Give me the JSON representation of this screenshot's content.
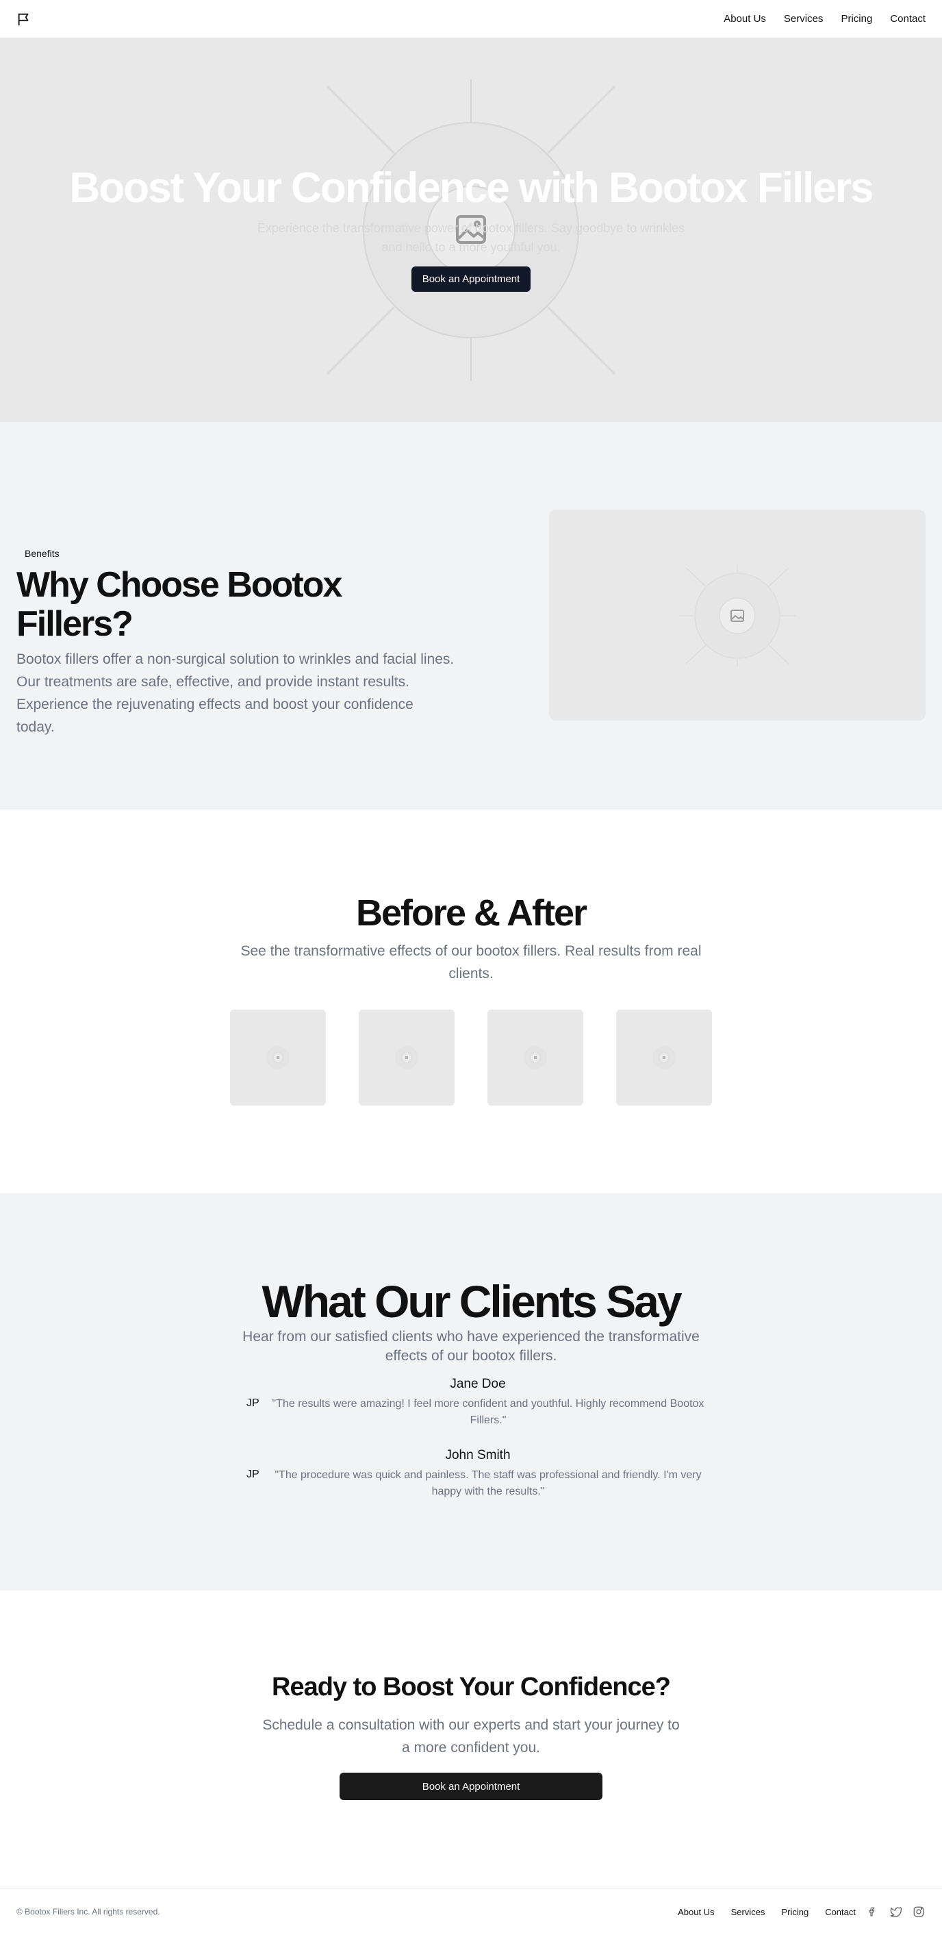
{
  "header": {
    "logo_icon": "flag-icon",
    "nav": [
      "About Us",
      "Services",
      "Pricing",
      "Contact"
    ]
  },
  "hero": {
    "title": "Boost Your Confidence with Bootox Fillers",
    "subtitle": "Experience the transformative power of bootox fillers. Say goodbye to wrinkles and hello to a more youthful you.",
    "cta": "Book an Appointment",
    "image_icon": "image-placeholder-icon"
  },
  "benefits": {
    "pill": "Benefits",
    "title": "Why Choose Bootox Fillers?",
    "description": "Bootox fillers offer a non-surgical solution to wrinkles and facial lines. Our treatments are safe, effective, and provide instant results. Experience the rejuvenating effects and boost your confidence today."
  },
  "before_after": {
    "title": "Before & After",
    "description": "See the transformative effects of our bootox fillers. Real results from real clients."
  },
  "testimonials": {
    "title": "What Our Clients Say",
    "description": "Hear from our satisfied clients who have experienced the transformative effects of our bootox fillers.",
    "items": [
      {
        "avatar": "JP",
        "name": "Jane Doe",
        "quote": "\"The results were amazing! I feel more confident and youthful. Highly recommend Bootox Fillers.\""
      },
      {
        "avatar": "JP",
        "name": "John Smith",
        "quote": "\"The procedure was quick and painless. The staff was professional and friendly. I'm very happy with the results.\""
      }
    ]
  },
  "cta": {
    "title": "Ready to Boost Your Confidence?",
    "description": "Schedule a consultation with our experts and start your journey to a more confident you.",
    "button": "Book an Appointment"
  },
  "footer": {
    "copyright": "© Bootox Fillers Inc. All rights reserved.",
    "links": [
      "About Us",
      "Services",
      "Pricing",
      "Contact"
    ],
    "social_icons": [
      "facebook-icon",
      "twitter-icon",
      "instagram-icon"
    ]
  },
  "colors": {
    "primary_button": "#111827",
    "placeholder_bg": "#e8e8e8",
    "section_gray": "#f2f3f5",
    "muted_text": "#6b7280"
  }
}
